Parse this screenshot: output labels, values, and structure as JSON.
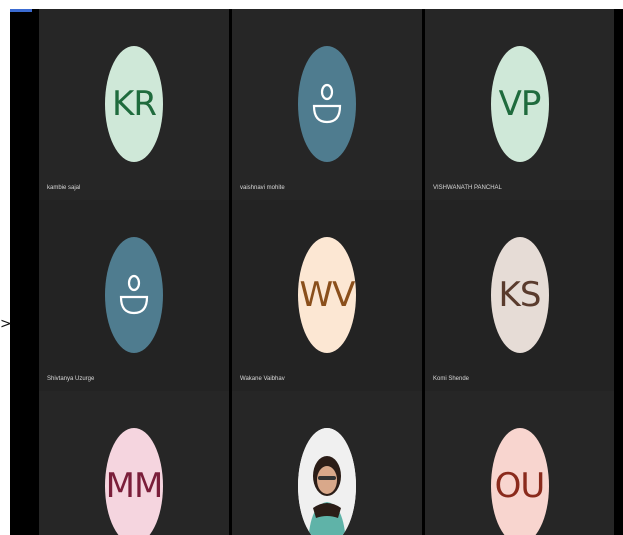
{
  "participants": [
    {
      "initials": "KR",
      "name": "kambie sajal",
      "bg": "#cfe8d8",
      "fg": "#1f6b3d",
      "kind": "initials"
    },
    {
      "initials": "",
      "name": "vaishnavi mohite",
      "bg": "#4f7c8f",
      "fg": "#ffffff",
      "kind": "person-icon"
    },
    {
      "initials": "VP",
      "name": "VISHWANATH PANCHAL",
      "bg": "#cfe8d8",
      "fg": "#1f6b3d",
      "kind": "initials"
    },
    {
      "initials": "",
      "name": "Shivtanya Uzurge",
      "bg": "#4f7c8f",
      "fg": "#ffffff",
      "kind": "person-icon"
    },
    {
      "initials": "WV",
      "name": "Wakane Vaibhav",
      "bg": "#fce7d3",
      "fg": "#8a4f1b",
      "kind": "initials"
    },
    {
      "initials": "KS",
      "name": "Komi Shende",
      "bg": "#e6dcd6",
      "fg": "#5a3b2d",
      "kind": "initials"
    },
    {
      "initials": "MM",
      "name": "",
      "bg": "#f5d5df",
      "fg": "#7a1e3a",
      "kind": "initials"
    },
    {
      "initials": "",
      "name": "",
      "bg": "#f2f2f2",
      "fg": "#333333",
      "kind": "photo"
    },
    {
      "initials": "OU",
      "name": "",
      "bg": "#f8d5cf",
      "fg": "#8a2a1c",
      "kind": "initials"
    }
  ],
  "nav": {
    "arrow": ">"
  }
}
